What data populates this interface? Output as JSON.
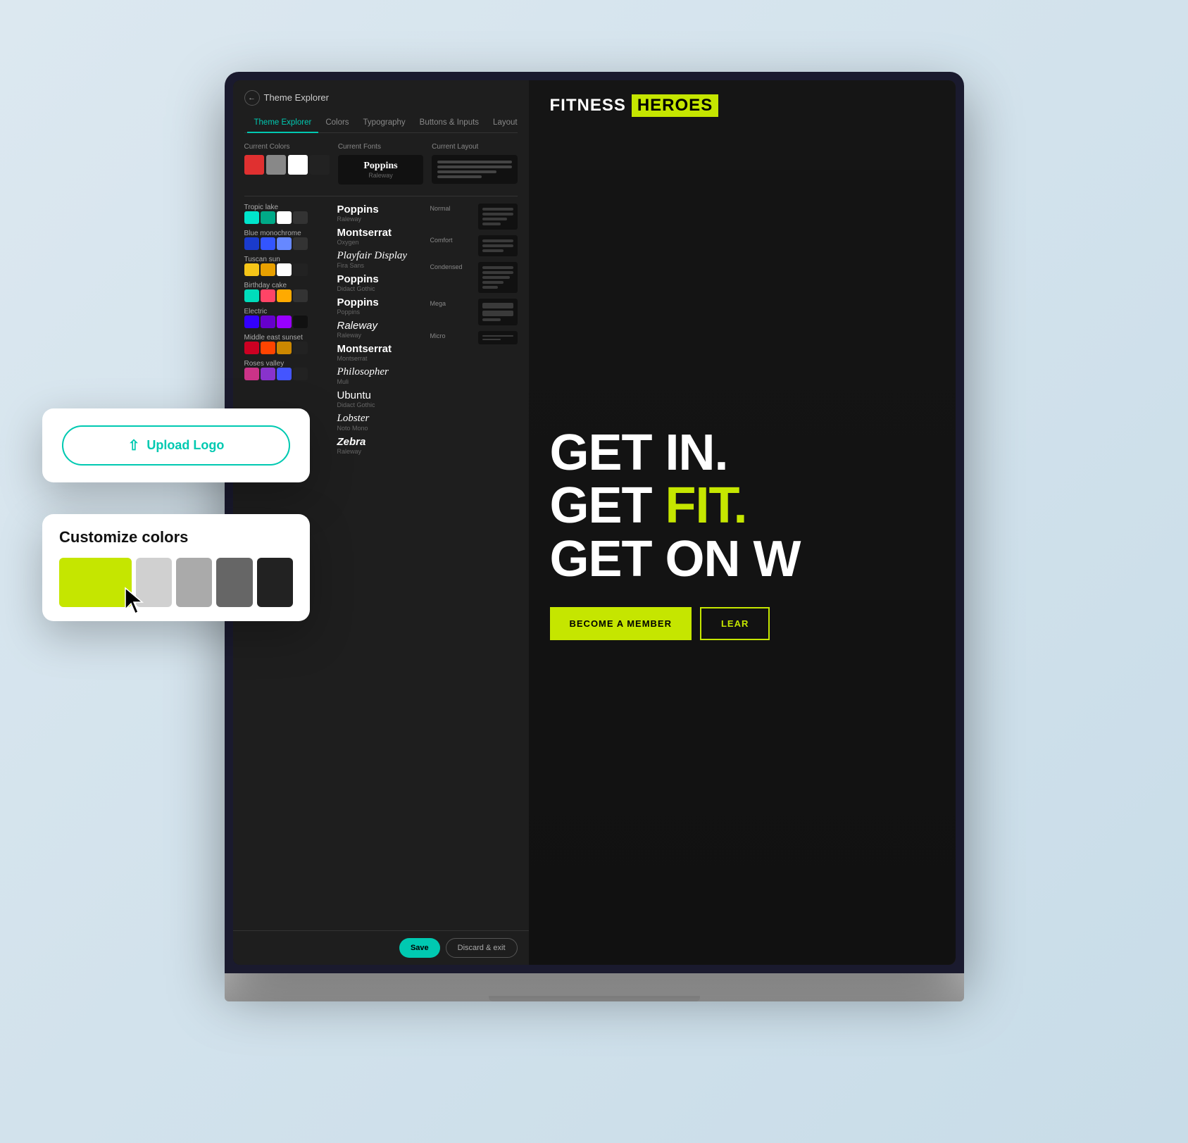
{
  "page": {
    "bg_color": "#dce8f0"
  },
  "panel": {
    "back_label": "Theme Explorer",
    "tabs": [
      {
        "label": "Theme Explorer",
        "active": true
      },
      {
        "label": "Colors",
        "active": false
      },
      {
        "label": "Typography",
        "active": false
      },
      {
        "label": "Buttons & Inputs",
        "active": false
      },
      {
        "label": "Layout",
        "active": false
      }
    ],
    "sections": {
      "current_colors_label": "Current Colors",
      "current_fonts_label": "Current Fonts",
      "current_layout_label": "Current Layout",
      "current_font_name": "Poppins",
      "current_font_sub": "Raleway"
    },
    "themes": [
      {
        "label": "Tropic lake",
        "colors": [
          "#00e5cc",
          "#00aa88",
          "#ffffff",
          "#333333"
        ]
      },
      {
        "label": "Blue monochrome",
        "colors": [
          "#1a3bcc",
          "#3355ff",
          "#6688ff",
          "#333333"
        ]
      },
      {
        "label": "Tuscan sun",
        "colors": [
          "#f5c518",
          "#e8a000",
          "#ffffff",
          "#222222"
        ]
      },
      {
        "label": "Birthday cake",
        "colors": [
          "#00ddbb",
          "#ff4466",
          "#ffaa00",
          "#333333"
        ]
      },
      {
        "label": "Electric",
        "colors": [
          "#3300ff",
          "#6600cc",
          "#9900ff",
          "#111111"
        ]
      },
      {
        "label": "Middle east sunset",
        "colors": [
          "#cc0022",
          "#ff4400",
          "#cc8800",
          "#222222"
        ]
      },
      {
        "label": "Roses valley",
        "colors": [
          "#cc3388",
          "#8833cc",
          "#4455ff",
          "#222222"
        ]
      }
    ],
    "fonts": [
      {
        "name": "Poppins",
        "sub": "Raleway",
        "style": "sans"
      },
      {
        "name": "Montserrat",
        "sub": "Oxygen",
        "style": "sans"
      },
      {
        "name": "Playfair Display",
        "sub": "Fira Sans",
        "style": "serif"
      },
      {
        "name": "Poppins",
        "sub": "Didact Gothic",
        "style": "sans"
      },
      {
        "name": "Poppins",
        "sub": "Poppins",
        "style": "sans"
      },
      {
        "name": "Raleway",
        "sub": "Raleway",
        "style": "sans"
      },
      {
        "name": "Montserrat",
        "sub": "Montserrat",
        "style": "sans"
      },
      {
        "name": "Philosopher",
        "sub": "Muli",
        "style": "serif"
      },
      {
        "name": "Ubuntu",
        "sub": "Didact Gothic",
        "style": "sans"
      },
      {
        "name": "Lobster",
        "sub": "Noto Mono",
        "style": "script"
      },
      {
        "name": "Zebra",
        "sub": "Raleway",
        "style": "sans"
      }
    ],
    "layouts": [
      {
        "label": "Normal",
        "lines": [
          100,
          100,
          80,
          60
        ]
      },
      {
        "label": "Comfort",
        "lines": [
          100,
          100,
          70
        ]
      },
      {
        "label": "Condensed",
        "lines": [
          100,
          100,
          90,
          70,
          50
        ]
      },
      {
        "label": "Mega",
        "lines": [
          100,
          100,
          60
        ]
      },
      {
        "label": "Micro",
        "lines": [
          100,
          60
        ]
      }
    ],
    "footer": {
      "save_label": "Save",
      "discard_label": "Discard & exit"
    }
  },
  "fitness": {
    "logo_fitness": "FITNESS",
    "logo_heroes": "HEROES",
    "headline_line1": "GET IN.",
    "headline_line2_pre": "GET ",
    "headline_line2_highlight": "FIT.",
    "headline_line3": "GET ON W",
    "btn_member": "BECOME A MEMBER",
    "btn_learn": "LEAR"
  },
  "upload_card": {
    "btn_label": "Upload Logo"
  },
  "customize_card": {
    "title": "Customize colors",
    "swatches": [
      "#c5e600",
      "#c5e600",
      "#cccccc",
      "#aaaaaa",
      "#888888",
      "#333333"
    ]
  }
}
